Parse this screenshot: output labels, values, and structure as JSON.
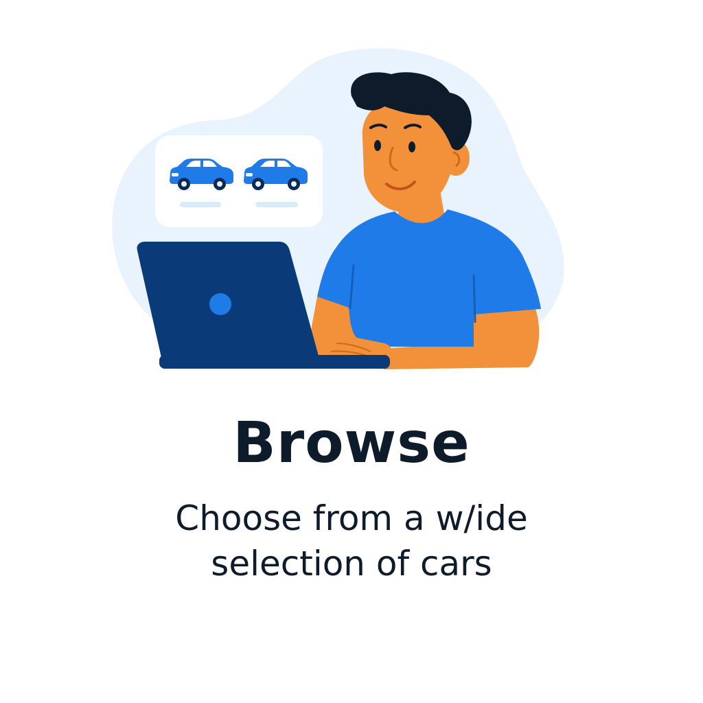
{
  "onboarding": {
    "title": "Browse",
    "subtitle_line1": "Choose from a w/ide",
    "subtitle_line2": "selection of cars"
  },
  "illustration": {
    "subject": "person-using-laptop",
    "icons": [
      "car-icon",
      "car-icon",
      "laptop-logo-icon"
    ],
    "colors": {
      "accent_blue": "#1e7be8",
      "navy": "#0b3a78",
      "skin": "#f2913a",
      "background_blob": "#e8f3fd",
      "text": "#0d1b2a"
    }
  }
}
